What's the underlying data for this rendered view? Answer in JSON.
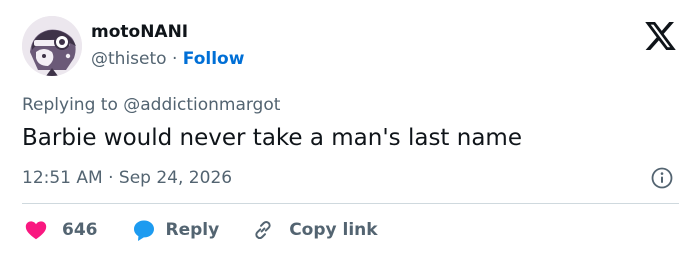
{
  "author": {
    "name": "motoNANI",
    "handle": "@thiseto",
    "separator": "·",
    "follow_label": "Follow"
  },
  "reply_context": {
    "prefix": "Replying to",
    "target": "@addictionmargot"
  },
  "tweet": {
    "text": "Barbie would never take a man's last name",
    "time": "12:51 AM",
    "separator": "·",
    "date": "Sep 24, 2026"
  },
  "actions": {
    "likes_count": "646",
    "reply_label": "Reply",
    "copy_link_label": "Copy link"
  },
  "colors": {
    "like": "#f91880",
    "reply": "#1d9bf0",
    "follow": "#006fd6",
    "secondary_text": "#536471",
    "primary_text": "#0f1419"
  },
  "icons": {
    "logo": "x-logo",
    "info": "info-icon",
    "like": "heart-icon",
    "reply": "speech-bubble-icon",
    "copy_link": "link-icon"
  }
}
